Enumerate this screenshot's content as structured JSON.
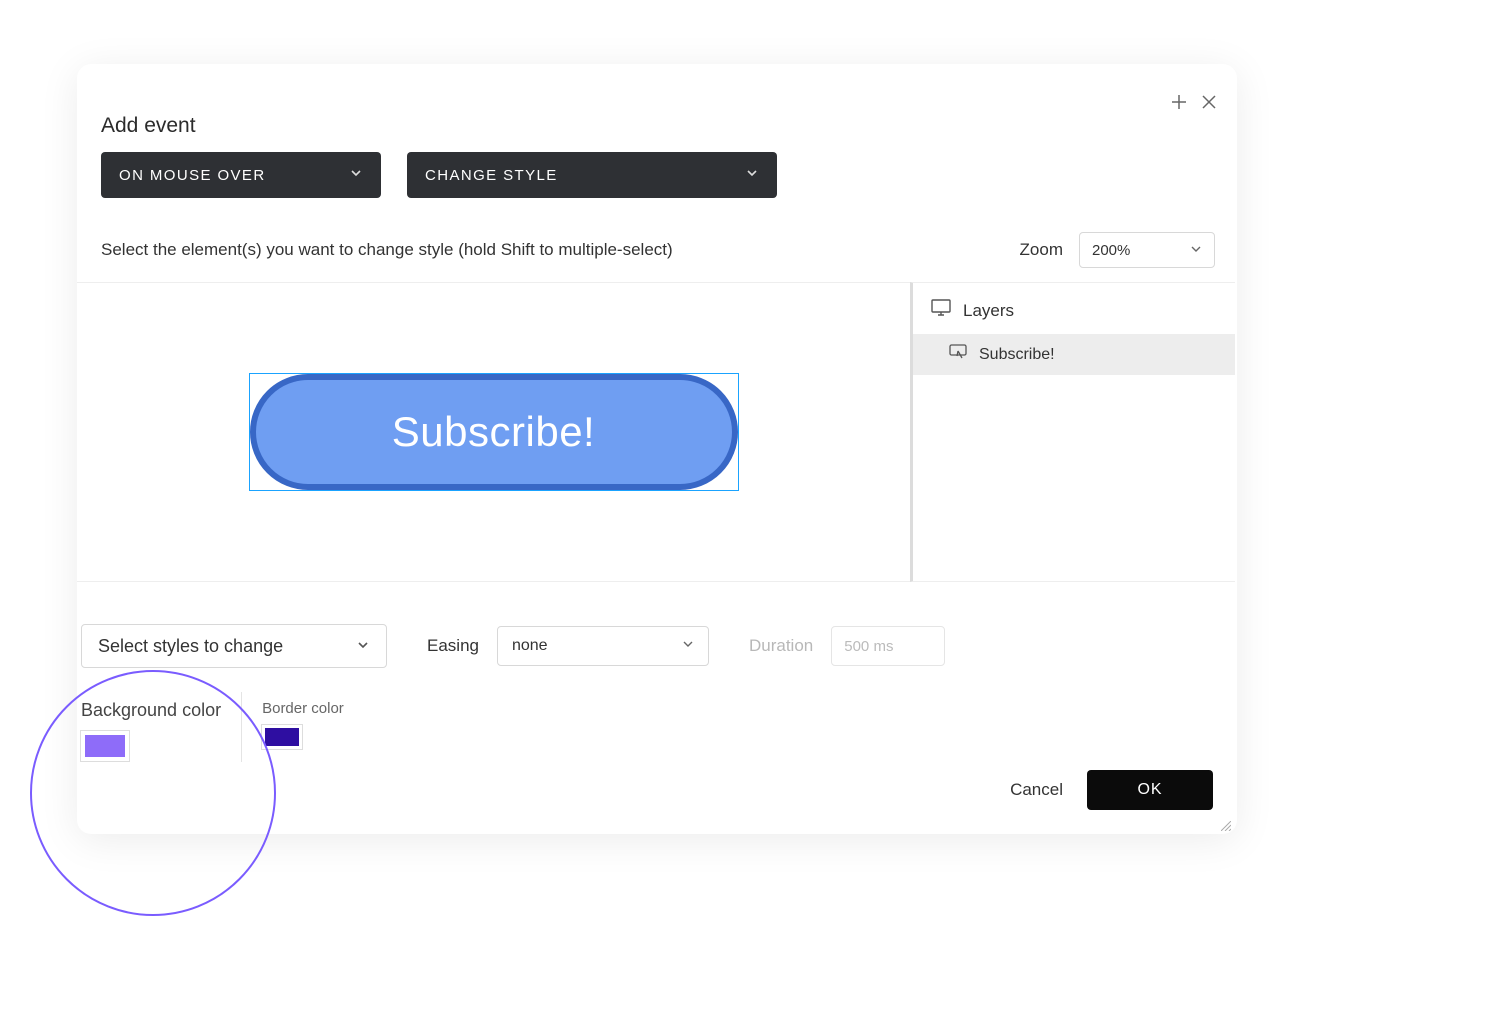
{
  "title": "Add event",
  "eventTrigger": {
    "label": "ON MOUSE OVER"
  },
  "eventAction": {
    "label": "CHANGE STYLE"
  },
  "instruction": "Select the element(s) you want to change style (hold Shift to multiple-select)",
  "zoom": {
    "label": "Zoom",
    "value": "200%"
  },
  "canvas": {
    "buttonText": "Subscribe!"
  },
  "layers": {
    "header": "Layers",
    "items": [
      {
        "label": "Subscribe!"
      }
    ]
  },
  "stylesSelect": {
    "label": "Select styles to change"
  },
  "easing": {
    "label": "Easing",
    "value": "none"
  },
  "duration": {
    "label": "Duration",
    "value": "500 ms"
  },
  "swatches": {
    "background": {
      "label": "Background color",
      "color": "#8e6cf9"
    },
    "border": {
      "label": "Border color",
      "color": "#2e0ea1"
    }
  },
  "footer": {
    "cancel": "Cancel",
    "ok": "OK"
  }
}
